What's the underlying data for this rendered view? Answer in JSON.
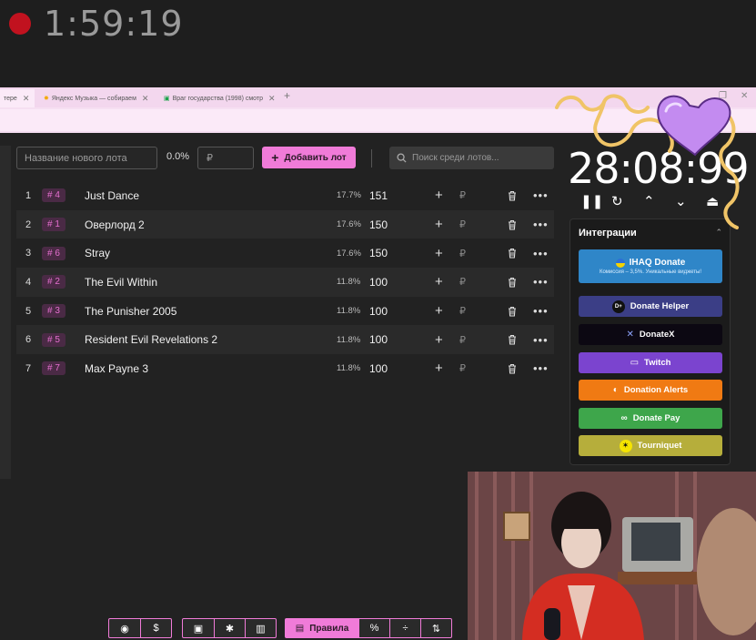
{
  "recorder": {
    "elapsed": "1:59:19"
  },
  "browser": {
    "tabs": [
      {
        "label": "тере",
        "active": true
      },
      {
        "label": "Яндекс Музыка — собираем"
      },
      {
        "label": "Враг государства (1998) смотр"
      }
    ]
  },
  "toolbar": {
    "lot_placeholder": "Название нового лота",
    "percent": "0.0%",
    "currency_placeholder": "₽",
    "add_label": "Добавить лот",
    "search_placeholder": "Поиск среди лотов..."
  },
  "lots": [
    {
      "index": "1",
      "tag": "# 4",
      "name": "Just Dance",
      "percent": "17.7%",
      "amount": "151"
    },
    {
      "index": "2",
      "tag": "# 1",
      "name": "Оверлорд 2",
      "percent": "17.6%",
      "amount": "150"
    },
    {
      "index": "3",
      "tag": "# 6",
      "name": "Stray",
      "percent": "17.6%",
      "amount": "150"
    },
    {
      "index": "4",
      "tag": "# 2",
      "name": "The Evil Within",
      "percent": "11.8%",
      "amount": "100"
    },
    {
      "index": "5",
      "tag": "# 3",
      "name": "The Punisher 2005",
      "percent": "11.8%",
      "amount": "100"
    },
    {
      "index": "6",
      "tag": "# 5",
      "name": "Resident Evil Revelations 2",
      "percent": "11.8%",
      "amount": "100"
    },
    {
      "index": "7",
      "tag": "# 7",
      "name": "Max Payne 3",
      "percent": "11.8%",
      "amount": "100"
    }
  ],
  "timer": {
    "display": "28:08:99"
  },
  "integrations": {
    "title": "Интеграции",
    "ihaq": {
      "label": "IHAQ Donate",
      "sub": "Комиссия – 3,5%. Уникальные виджеты!"
    },
    "services": {
      "donate_helper": "Donate Helper",
      "donatex": "DonateX",
      "twitch": "Twitch",
      "donation_alerts": "Donation Alerts",
      "donate_pay": "Donate Pay",
      "tourniquet": "Tourniquet"
    }
  },
  "bottom_bar": {
    "rules_label": "Правила",
    "percent_symbol": "%"
  },
  "colors": {
    "accent": "#f07bd8",
    "background": "#222222",
    "record": "#c1121f"
  }
}
